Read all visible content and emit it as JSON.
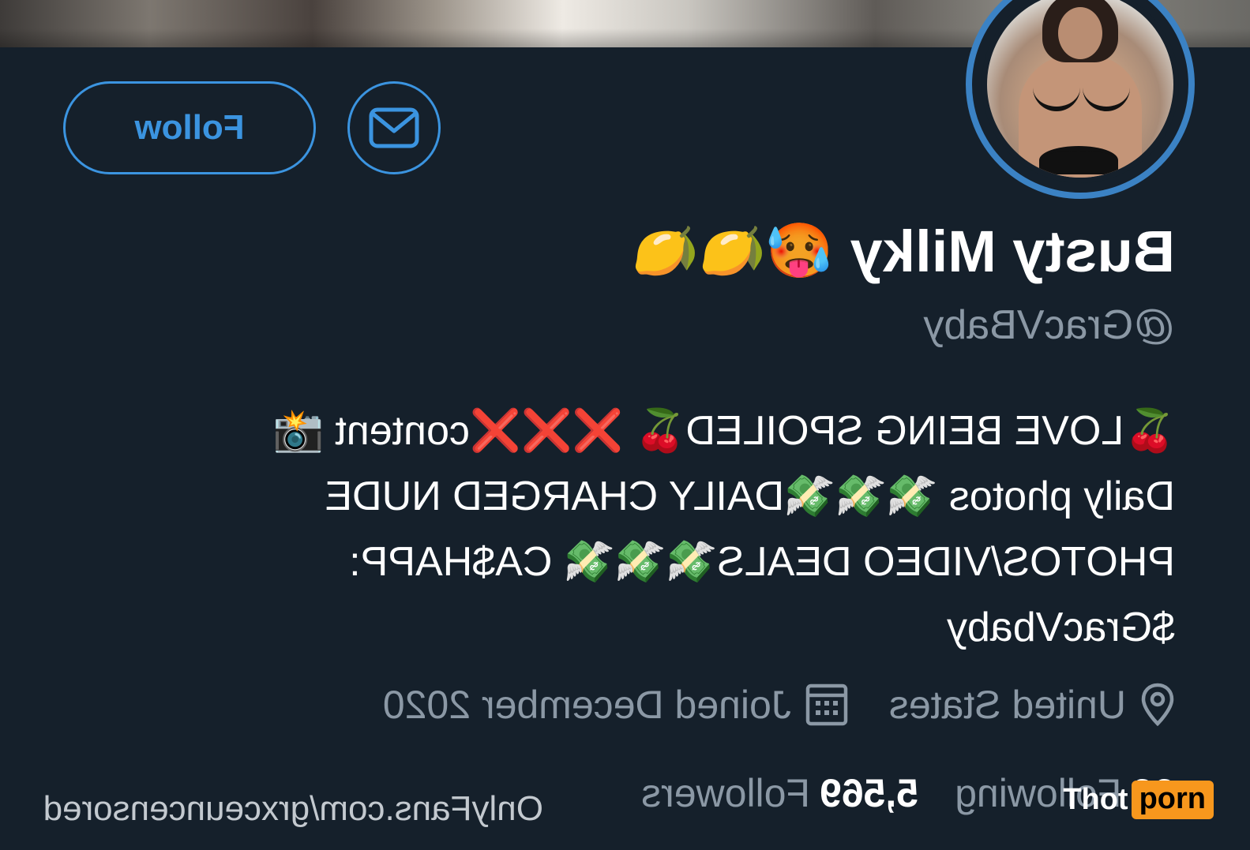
{
  "profile": {
    "display_name": "Busty Milky",
    "name_emoji": "🥵🍋🍋",
    "handle": "@GracVBaby",
    "follow_label": "Follow",
    "bio_lines": [
      "🍒LOVE BEING SPOILED🍒 ❌❌❌content 📸",
      "Daily photos 💸💸💸DAILY CHARGED NUDE",
      "PHOTOS/VIDEO DEALS💸💸💸 CA$HAPP:",
      "$GracVbaby"
    ],
    "location": "United States",
    "joined": "Joined December 2020",
    "following_count": "99",
    "following_label": "Following",
    "followers_count": "5,569",
    "followers_label": "Followers",
    "website": "OnlyFans.com/grxceuncensored"
  },
  "icons": {
    "message": "envelope-icon",
    "location": "map-pin-icon",
    "joined": "calendar-icon"
  },
  "colors": {
    "background": "#15202b",
    "accent": "#3b94e0",
    "secondary_text": "#8b98a5",
    "watermark_orange": "#f7971d"
  },
  "watermark": {
    "left": "Thot",
    "right": "porn"
  }
}
